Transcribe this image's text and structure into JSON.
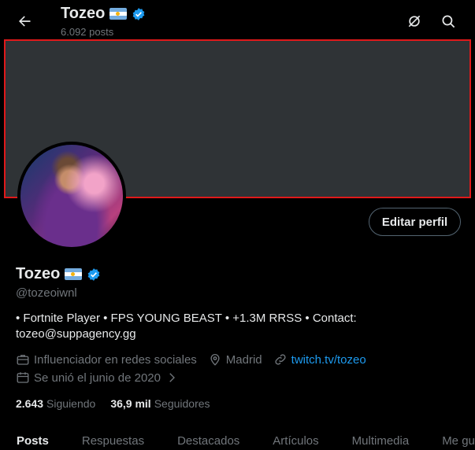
{
  "header": {
    "title": "Tozeo",
    "posts_count": "6.092 posts",
    "icons": [
      "back-arrow-icon",
      "grok-icon",
      "search-icon"
    ]
  },
  "profile": {
    "name": "Tozeo",
    "handle": "@tozeoiwnl",
    "edit_button": "Editar perfil",
    "bio": "• Fortnite Player • FPS YOUNG BEAST • +1.3M RRSS • Contact: tozeo@suppagency.gg",
    "category": "Influenciador en redes sociales",
    "location": "Madrid",
    "website": "twitch.tv/tozeo",
    "joined": "Se unió el junio de 2020",
    "following_count": "2.643",
    "following_label": "Siguiendo",
    "followers_count": "36,9 mil",
    "followers_label": "Seguidores"
  },
  "tabs": [
    "Posts",
    "Respuestas",
    "Destacados",
    "Artículos",
    "Multimedia",
    "Me gusta"
  ],
  "colors": {
    "background": "#000000",
    "banner": "#2f3336",
    "highlight_outline": "#e0191a",
    "accent": "#1d9bf0",
    "muted_text": "#71767b"
  }
}
